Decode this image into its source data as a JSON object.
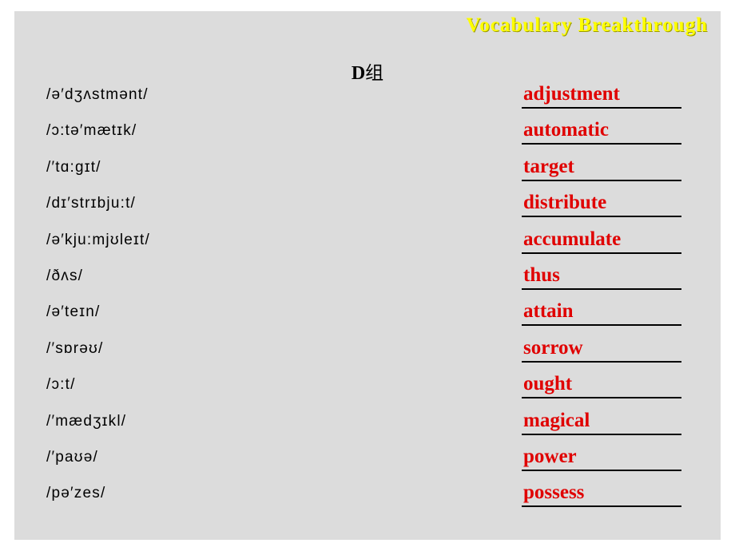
{
  "header": {
    "title": "Vocabulary   Breakthrough",
    "color": "#ffff00"
  },
  "group": {
    "label": "D",
    "cn_label": "组"
  },
  "theme": {
    "background": "#dcdcdc",
    "word_color": "#e00000",
    "text_color": "#000000"
  },
  "rows": [
    {
      "phonetic": "/ə′dʒʌstmənt/",
      "word": "adjustment"
    },
    {
      "phonetic": "/ɔ:tə′mætɪk/",
      "word": "automatic"
    },
    {
      "phonetic": "/′tɑ:gɪt/",
      "word": "target"
    },
    {
      "phonetic": "/dɪ′strɪbju:t/",
      "word": "distribute"
    },
    {
      "phonetic": "/ə′kju:mjʊleɪt/",
      "word": "accumulate"
    },
    {
      "phonetic": "/ðʌs/",
      "word": "thus"
    },
    {
      "phonetic": "/ə′teɪn/",
      "word": "attain"
    },
    {
      "phonetic": "/′sɒrəʊ/",
      "word": "sorrow"
    },
    {
      "phonetic": "/ɔ:t/",
      "word": "ought"
    },
    {
      "phonetic": "/′mædʒɪkl/",
      "word": "magical"
    },
    {
      "phonetic": "/′paʊə/",
      "word": "power"
    },
    {
      "phonetic": "/pə′zes/",
      "word": "possess"
    }
  ]
}
